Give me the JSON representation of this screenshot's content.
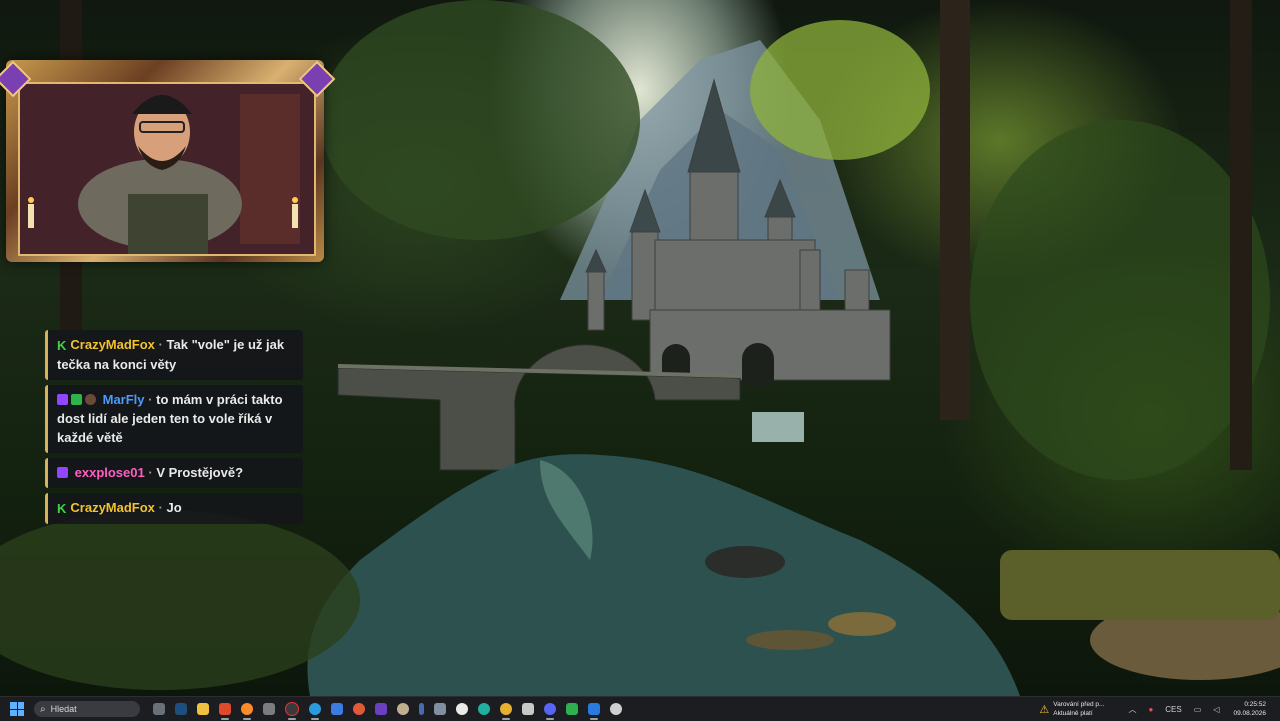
{
  "chat": {
    "messages": [
      {
        "user": "CrazyMadFox",
        "user_color": "#f2c230",
        "badges": [
          "kick-badge"
        ],
        "text": "Tak \"vole\" je už jak tečka na konci věty"
      },
      {
        "user": "MarFly",
        "user_color": "#4a9bff",
        "badges": [
          "twitch-badge",
          "game-badge",
          "orb-badge"
        ],
        "text": "to mám v práci takto dost lidí ale jeden ten to vole říká v každé větě"
      },
      {
        "user": "exxplose01",
        "user_color": "#ff5ec4",
        "badges": [
          "twitch-badge"
        ],
        "text": "V Prostějově?"
      },
      {
        "user": "CrazyMadFox",
        "user_color": "#f2c230",
        "badges": [
          "kick-badge"
        ],
        "text": "Jo"
      }
    ],
    "separator": "·",
    "kick_glyph": "K"
  },
  "taskbar": {
    "search_placeholder": "Hledat",
    "notification": {
      "title": "Varování před p...",
      "subtitle": "Aktuálně platí"
    },
    "language": "CES",
    "time": "0:25:52",
    "date": "09.08.2026",
    "apps": [
      "task-view-icon",
      "steam-icon",
      "file-explorer-icon",
      "brave-icon",
      "firefox-icon",
      "app-icon",
      "obs-icon",
      "edge-icon",
      "store-icon",
      "app-icon",
      "app-icon",
      "app-icon",
      "app-icon",
      "app-icon",
      "github-icon",
      "edge-dev-icon",
      "chrome-icon",
      "notepad-icon",
      "discord-icon",
      "media-player-icon",
      "vscode-icon",
      "app-icon"
    ]
  },
  "colors": {
    "accent": "#d8b25a",
    "kick": "#3fd34a",
    "twitch": "#9146ff"
  }
}
